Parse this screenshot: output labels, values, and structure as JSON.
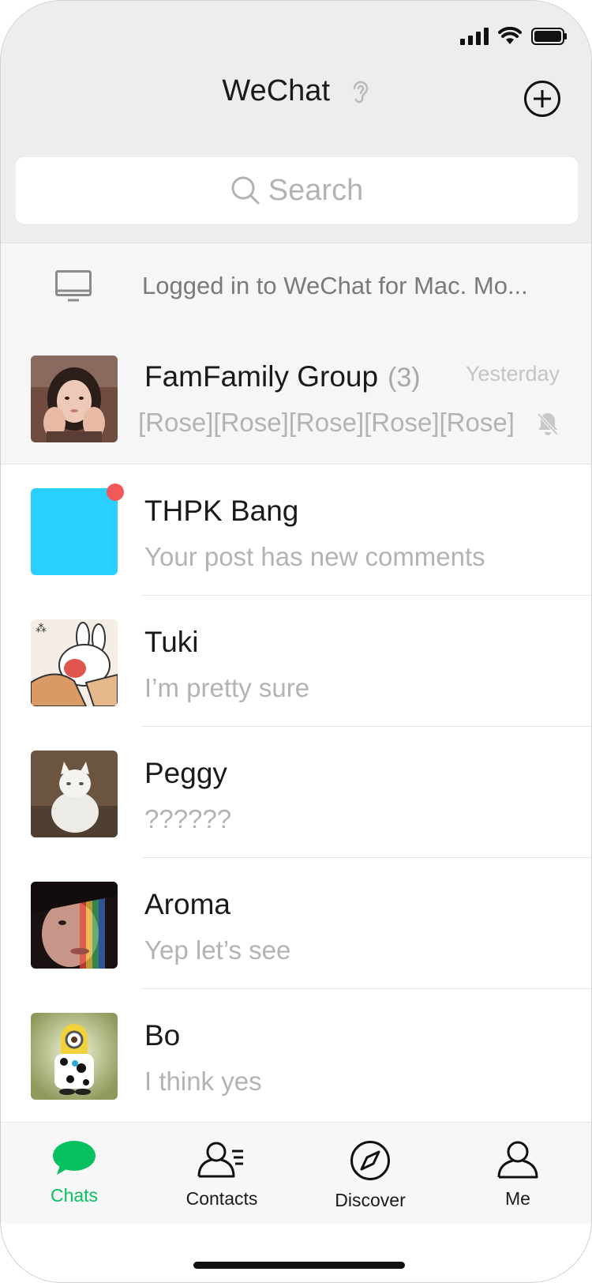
{
  "header": {
    "title": "WeChat",
    "search_placeholder": "Search"
  },
  "login_banner": {
    "text": "Logged in to WeChat for Mac. Mo..."
  },
  "chats": [
    {
      "name": "FamFamily Group",
      "count": "(3)",
      "time": "Yesterday",
      "message": "[Rose][Rose][Rose][Rose][Rose]",
      "muted": true,
      "pinned": true,
      "avatar": "photo-girl"
    },
    {
      "name": "THPK Bang",
      "message": "Your post has new comments",
      "unread_dot": true,
      "avatar": "blue-square",
      "avatar_color": "#29d0ff"
    },
    {
      "name": "Tuki",
      "message": "I’m pretty sure",
      "avatar": "bunny-illustration"
    },
    {
      "name": "Peggy",
      "message": "??????",
      "avatar": "photo-cat"
    },
    {
      "name": "Aroma",
      "message": "Yep let’s see",
      "avatar": "photo-face"
    },
    {
      "name": "Bo",
      "message": "I think yes",
      "avatar": "minion-illustration"
    }
  ],
  "tabbar": {
    "tabs": [
      {
        "label": "Chats",
        "icon": "chat-bubble-icon",
        "active": true
      },
      {
        "label": "Contacts",
        "icon": "contacts-icon"
      },
      {
        "label": "Discover",
        "icon": "compass-icon"
      },
      {
        "label": "Me",
        "icon": "person-icon"
      }
    ],
    "active_color": "#07c160"
  }
}
